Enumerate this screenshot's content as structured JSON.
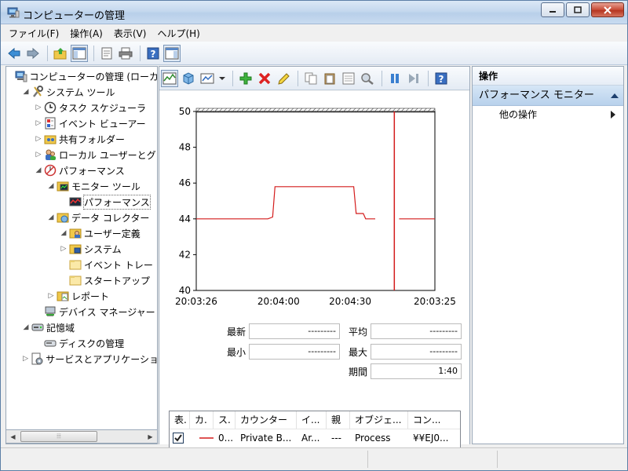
{
  "window": {
    "title": "コンピューターの管理"
  },
  "menu": [
    "ファイル(F)",
    "操作(A)",
    "表示(V)",
    "ヘルプ(H)"
  ],
  "tree": [
    {
      "label": "コンピューターの管理 (ローカ",
      "level": 0,
      "expander": "",
      "icon": "computer-management-icon"
    },
    {
      "label": "システム ツール",
      "level": 1,
      "expander": "◢",
      "icon": "system-tools-icon"
    },
    {
      "label": "タスク スケジューラ",
      "level": 2,
      "expander": "▷",
      "icon": "clock-icon"
    },
    {
      "label": "イベント ビューアー",
      "level": 2,
      "expander": "▷",
      "icon": "event-viewer-icon"
    },
    {
      "label": "共有フォルダー",
      "level": 2,
      "expander": "▷",
      "icon": "shared-folder-icon"
    },
    {
      "label": "ローカル ユーザーとグ",
      "level": 2,
      "expander": "▷",
      "icon": "users-icon"
    },
    {
      "label": "パフォーマンス",
      "level": 2,
      "expander": "◢",
      "icon": "performance-icon"
    },
    {
      "label": "モニター ツール",
      "level": 3,
      "expander": "◢",
      "icon": "folder-monitor-icon"
    },
    {
      "label": "パフォーマンス",
      "level": 4,
      "expander": "",
      "icon": "perf-monitor-icon",
      "selected": true
    },
    {
      "label": "データ コレクター",
      "level": 3,
      "expander": "◢",
      "icon": "folder-collector-icon"
    },
    {
      "label": "ユーザー定義",
      "level": 4,
      "expander": "◢",
      "icon": "folder-user-icon"
    },
    {
      "label": "システム",
      "level": 4,
      "expander": "▷",
      "icon": "folder-system-icon"
    },
    {
      "label": "イベント トレー",
      "level": 4,
      "expander": "",
      "icon": "folder-icon"
    },
    {
      "label": "スタートアップ",
      "level": 4,
      "expander": "",
      "icon": "folder-icon"
    },
    {
      "label": "レポート",
      "level": 3,
      "expander": "▷",
      "icon": "folder-report-icon"
    },
    {
      "label": "デバイス マネージャー",
      "level": 2,
      "expander": "",
      "icon": "device-manager-icon"
    },
    {
      "label": "記憶域",
      "level": 1,
      "expander": "◢",
      "icon": "storage-icon"
    },
    {
      "label": "ディスクの管理",
      "level": 2,
      "expander": "",
      "icon": "disk-icon"
    },
    {
      "label": "サービスとアプリケーショ",
      "level": 1,
      "expander": "▷",
      "icon": "services-icon"
    }
  ],
  "chart_data": {
    "type": "line",
    "title": "",
    "xlabel": "",
    "ylabel": "",
    "ylim": [
      40,
      50
    ],
    "yticks": [
      40,
      42,
      44,
      46,
      48,
      50
    ],
    "xtick_labels": [
      "20:03:26",
      "20:04:00",
      "20:04:30",
      "20:03:25"
    ],
    "series": [
      {
        "color": "#d41c1c",
        "x_seconds": [
          0,
          30,
          32,
          33,
          66,
          67,
          70,
          71,
          75
        ],
        "values": [
          44.0,
          44.0,
          44.1,
          45.8,
          45.8,
          44.3,
          44.3,
          44.0,
          44.0
        ]
      }
    ],
    "time_bar_at_seconds": 83,
    "gap_after_seconds": 85,
    "duration_seconds": 100
  },
  "stats": {
    "latest_label": "最新",
    "latest_value": "---------",
    "avg_label": "平均",
    "avg_value": "---------",
    "min_label": "最小",
    "min_value": "---------",
    "max_label": "最大",
    "max_value": "---------",
    "duration_label": "期間",
    "duration_value": "1:40"
  },
  "counter_table": {
    "headers": [
      "表.",
      "カ.",
      "ス.",
      "カウンター",
      "イ...",
      "親",
      "オブジェ...",
      "コン..."
    ],
    "row": {
      "checked": true,
      "scale": "0...",
      "counter": "Private B...",
      "instance": "Ar...",
      "parent": "---",
      "object": "Process",
      "computer": "¥¥EJ0..."
    }
  },
  "actions": {
    "header": "操作",
    "section": "パフォーマンス モニター",
    "item": "他の操作"
  },
  "colors": {
    "accent": "#d41c1c",
    "selection": "#cde4f7"
  }
}
